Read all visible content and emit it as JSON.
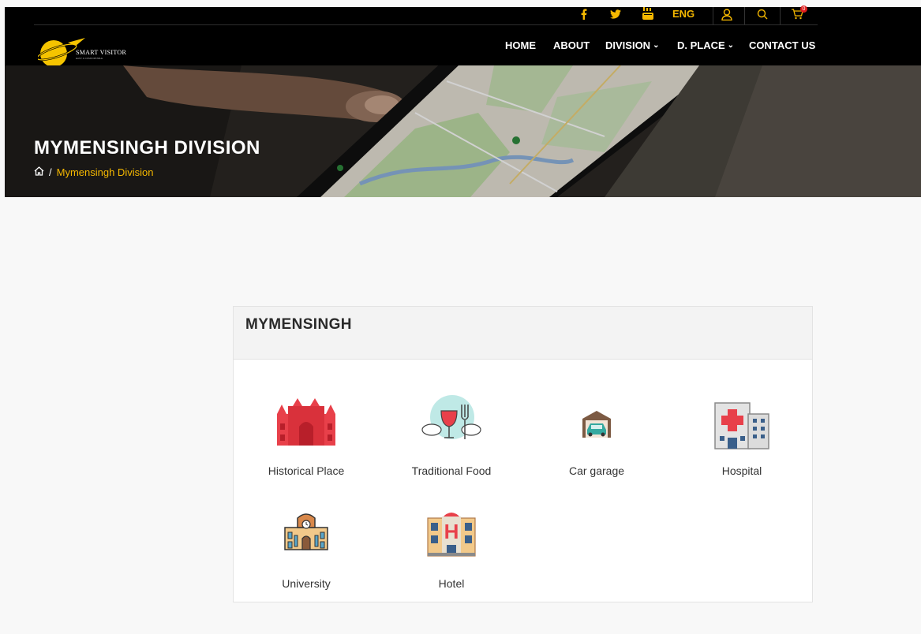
{
  "header": {
    "social": [
      {
        "name": "facebook",
        "glyph": "f"
      },
      {
        "name": "twitter",
        "glyph": "t"
      },
      {
        "name": "youtube",
        "glyph": "You"
      }
    ],
    "language": "ENG",
    "cart_count": "0",
    "logo": {
      "text": "SMART VISITOR",
      "tagline": "EASY & COMFORTABLE"
    },
    "nav": [
      {
        "label": "HOME",
        "dropdown": false
      },
      {
        "label": "ABOUT",
        "dropdown": false
      },
      {
        "label": "DIVISION",
        "dropdown": true
      },
      {
        "label": "D. PLACE",
        "dropdown": true
      },
      {
        "label": "CONTACT US",
        "dropdown": false
      }
    ],
    "chevron": "⌄"
  },
  "hero": {
    "title": "MYMENSINGH DIVISION",
    "breadcrumb_sep": "/",
    "breadcrumb_current": "Mymensingh Division"
  },
  "card": {
    "title": "MYMENSINGH",
    "categories": [
      {
        "label": "Historical Place",
        "icon": "fort-icon"
      },
      {
        "label": "Traditional Food",
        "icon": "food-icon"
      },
      {
        "label": "Car garage",
        "icon": "car-garage-icon"
      },
      {
        "label": "Hospital",
        "icon": "hospital-icon"
      },
      {
        "label": "University",
        "icon": "university-icon"
      },
      {
        "label": "Hotel",
        "icon": "hotel-icon"
      }
    ]
  },
  "colors": {
    "accent": "#f5b800",
    "nav_bg": "#000000",
    "badge": "#e01c1c"
  }
}
